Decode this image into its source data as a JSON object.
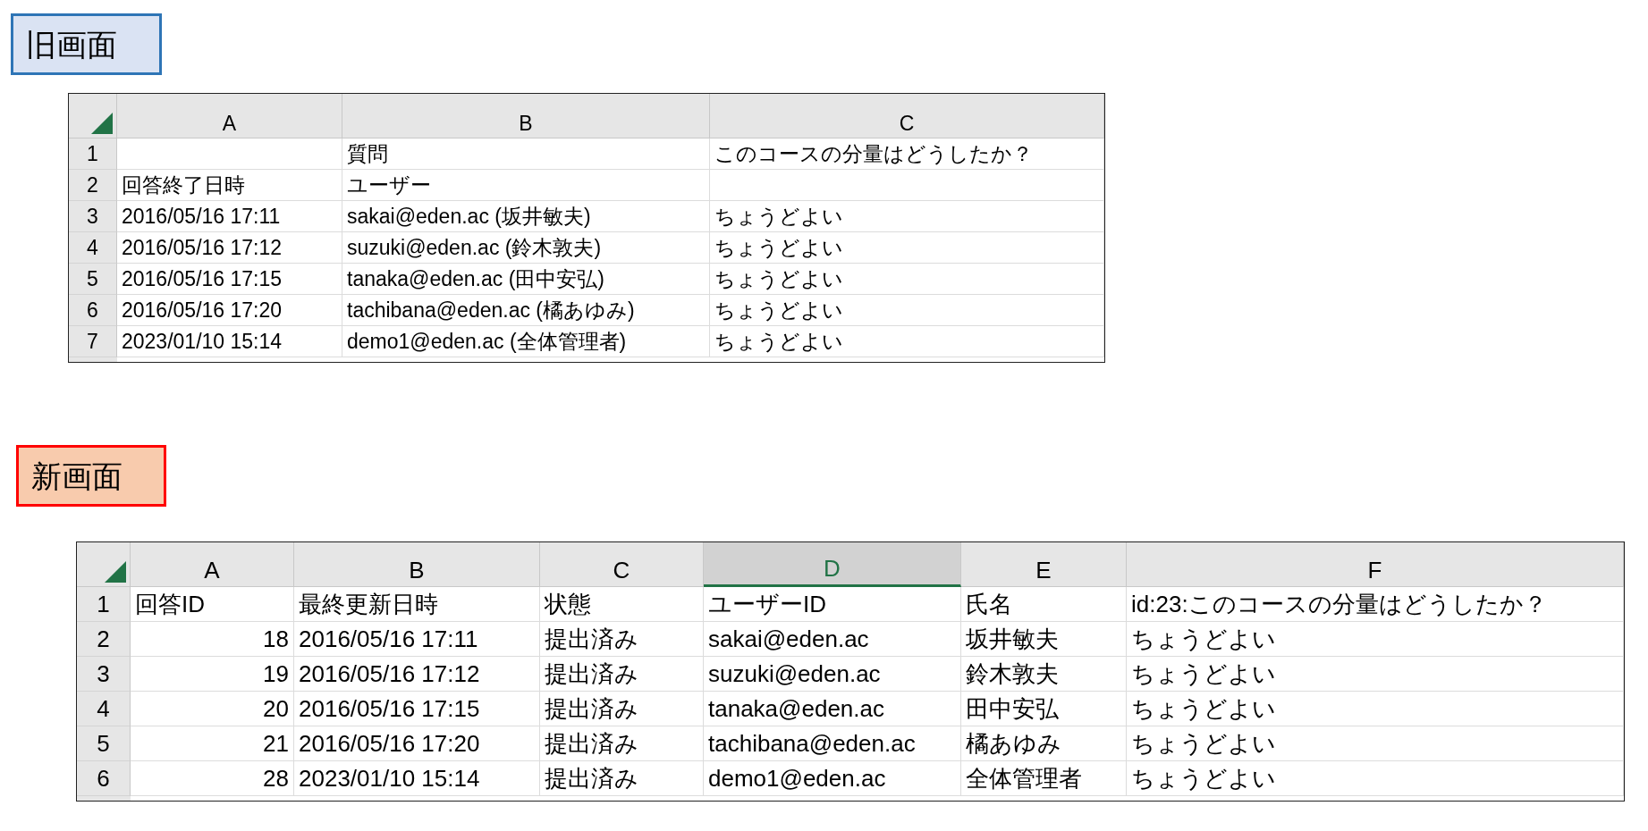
{
  "screens": [
    {
      "kind": "old",
      "label": "旧画面",
      "sheet": {
        "columns": [
          {
            "letter": "A",
            "kind": "text",
            "selected": false
          },
          {
            "letter": "B",
            "kind": "text",
            "selected": false
          },
          {
            "letter": "C",
            "kind": "text",
            "selected": false
          }
        ],
        "rows": [
          {
            "number": "1",
            "cells": [
              null,
              "質問",
              "このコースの分量はどうしたか？"
            ]
          },
          {
            "number": "2",
            "cells": [
              "回答終了日時",
              "ユーザー",
              null
            ]
          },
          {
            "number": "3",
            "cells": [
              "2016/05/16 17:11",
              "sakai@eden.ac (坂井敏夫)",
              "ちょうどよい"
            ]
          },
          {
            "number": "4",
            "cells": [
              "2016/05/16 17:12",
              "suzuki@eden.ac (鈴木敦夫)",
              "ちょうどよい"
            ]
          },
          {
            "number": "5",
            "cells": [
              "2016/05/16 17:15",
              "tanaka@eden.ac (田中安弘)",
              "ちょうどよい"
            ]
          },
          {
            "number": "6",
            "cells": [
              "2016/05/16 17:20",
              "tachibana@eden.ac (橘あゆみ)",
              "ちょうどよい"
            ]
          },
          {
            "number": "7",
            "cells": [
              "2023/01/10 15:14",
              "demo1@eden.ac (全体管理者)",
              "ちょうどよい"
            ]
          }
        ]
      }
    },
    {
      "kind": "new",
      "label": "新画面",
      "sheet": {
        "columns": [
          {
            "letter": "A",
            "kind": "number",
            "selected": false
          },
          {
            "letter": "B",
            "kind": "text",
            "selected": false
          },
          {
            "letter": "C",
            "kind": "text",
            "selected": false
          },
          {
            "letter": "D",
            "kind": "text",
            "selected": true
          },
          {
            "letter": "E",
            "kind": "text",
            "selected": false
          },
          {
            "letter": "F",
            "kind": "text",
            "selected": false
          }
        ],
        "rows": [
          {
            "number": "1",
            "header": true,
            "cells": [
              "回答ID",
              "最終更新日時",
              "状態",
              "ユーザーID",
              "氏名",
              "id:23:このコースの分量はどうしたか？"
            ]
          },
          {
            "number": "2",
            "cells": [
              "18",
              "2016/05/16 17:11",
              "提出済み",
              "sakai@eden.ac",
              "坂井敏夫",
              "ちょうどよい"
            ]
          },
          {
            "number": "3",
            "cells": [
              "19",
              "2016/05/16 17:12",
              "提出済み",
              "suzuki@eden.ac",
              "鈴木敦夫",
              "ちょうどよい"
            ]
          },
          {
            "number": "4",
            "cells": [
              "20",
              "2016/05/16 17:15",
              "提出済み",
              "tanaka@eden.ac",
              "田中安弘",
              "ちょうどよい"
            ]
          },
          {
            "number": "5",
            "cells": [
              "21",
              "2016/05/16 17:20",
              "提出済み",
              "tachibana@eden.ac",
              "橘あゆみ",
              "ちょうどよい"
            ]
          },
          {
            "number": "6",
            "cells": [
              "28",
              "2023/01/10 15:14",
              "提出済み",
              "demo1@eden.ac",
              "全体管理者",
              "ちょうどよい"
            ]
          }
        ]
      }
    }
  ]
}
